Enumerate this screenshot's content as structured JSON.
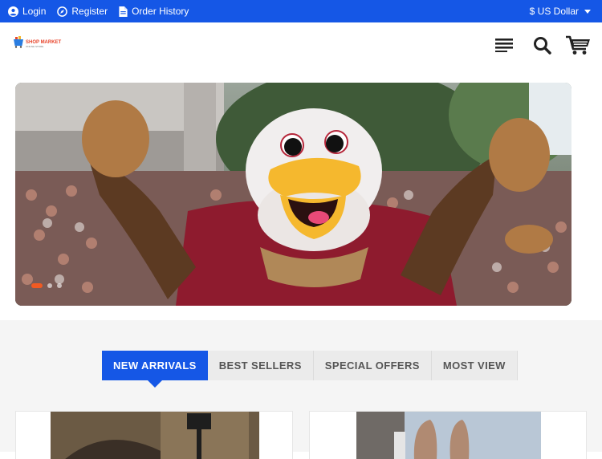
{
  "topbar": {
    "login_label": "Login",
    "register_label": "Register",
    "order_history_label": "Order History",
    "currency_label": "$ US Dollar"
  },
  "brand": {
    "logo_text": "SHOP MARKET",
    "logo_subtext": "ONLINE STORE"
  },
  "header": {
    "icons": [
      "menu-icon",
      "search-icon",
      "cart-icon"
    ]
  },
  "banner": {
    "slide_count": 3,
    "active_slide": 1
  },
  "tabs": {
    "items": [
      {
        "label": "NEW ARRIVALS",
        "active": true
      },
      {
        "label": "BEST SELLERS",
        "active": false
      },
      {
        "label": "SPECIAL OFFERS",
        "active": false
      },
      {
        "label": "MOST VIEW",
        "active": false
      }
    ]
  },
  "colors": {
    "primary": "#1557e6",
    "accent": "#f05a22"
  }
}
